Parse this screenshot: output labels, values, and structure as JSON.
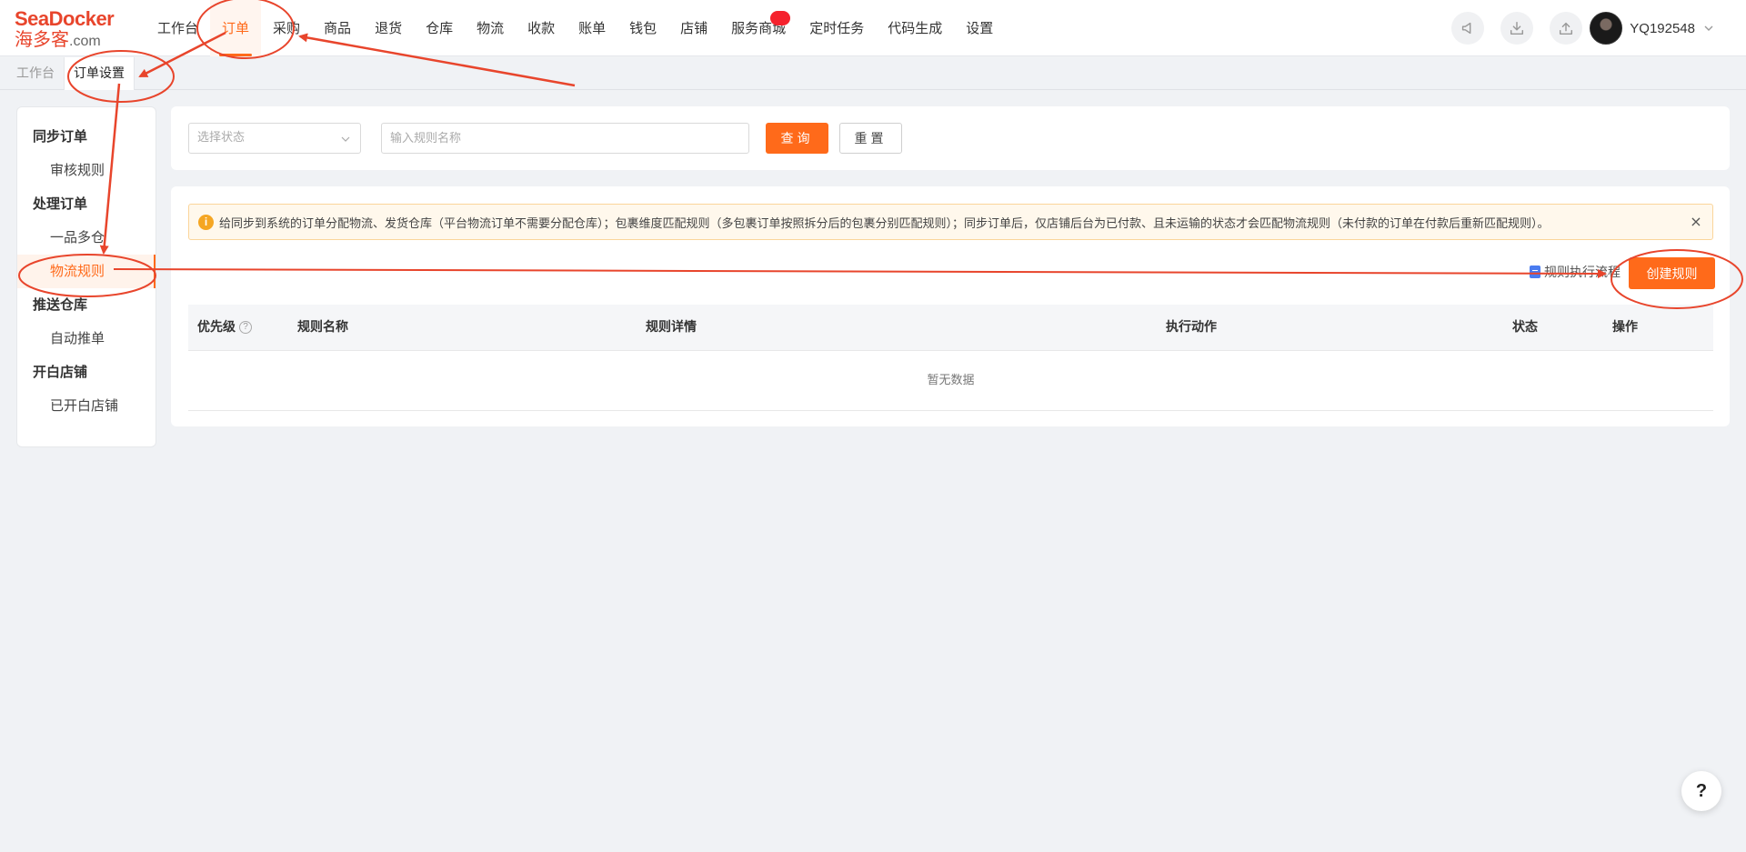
{
  "logo": {
    "brand": "SeaDocker",
    "cn": "海多客",
    "domain": ".com"
  },
  "nav": {
    "items": [
      {
        "label": "工作台"
      },
      {
        "label": "订单",
        "active": true
      },
      {
        "label": "采购"
      },
      {
        "label": "商品"
      },
      {
        "label": "退货"
      },
      {
        "label": "仓库"
      },
      {
        "label": "物流"
      },
      {
        "label": "收款"
      },
      {
        "label": "账单"
      },
      {
        "label": "钱包"
      },
      {
        "label": "店铺"
      },
      {
        "label": "服务商城",
        "badge": ""
      },
      {
        "label": "定时任务"
      },
      {
        "label": "代码生成"
      },
      {
        "label": "设置"
      }
    ]
  },
  "header": {
    "icons": [
      "megaphone-icon",
      "download-icon",
      "upload-icon"
    ],
    "user_name": "YQ192548"
  },
  "tabs": [
    {
      "label": "工作台"
    },
    {
      "label": "订单设置",
      "active": true
    }
  ],
  "side": {
    "groups": [
      {
        "title": "同步订单",
        "items": [
          "审核规则"
        ]
      },
      {
        "title": "处理订单",
        "items": [
          "一品多仓",
          "物流规则"
        ]
      },
      {
        "title": "推送仓库",
        "items": [
          "自动推单"
        ]
      },
      {
        "title": "开白店铺",
        "items": [
          "已开白店铺"
        ]
      }
    ],
    "active_item": "物流规则"
  },
  "filter": {
    "status_placeholder": "选择状态",
    "name_placeholder": "输入规则名称",
    "query_label": "查询",
    "reset_label": "重置"
  },
  "alert": {
    "text": "给同步到系统的订单分配物流、发货仓库（平台物流订单不需要分配仓库）；包裹维度匹配规则（多包裹订单按照拆分后的包裹分别匹配规则）；同步订单后，仅店铺后台为已付款、且未运输的状态才会匹配物流规则（未付款的订单在付款后重新匹配规则）。",
    "close": "×"
  },
  "actions": {
    "flow_link": "规则执行流程",
    "create_label": "创建规则"
  },
  "table": {
    "columns": [
      "优先级",
      "规则名称",
      "规则详情",
      "执行动作",
      "状态",
      "操作"
    ],
    "help_glyph": "?",
    "empty_text": "暂无数据"
  },
  "float_help": "?",
  "colors": {
    "accent": "#ff6a1a",
    "annotation": "#e8452c",
    "alert_bg": "#fff8ec"
  }
}
